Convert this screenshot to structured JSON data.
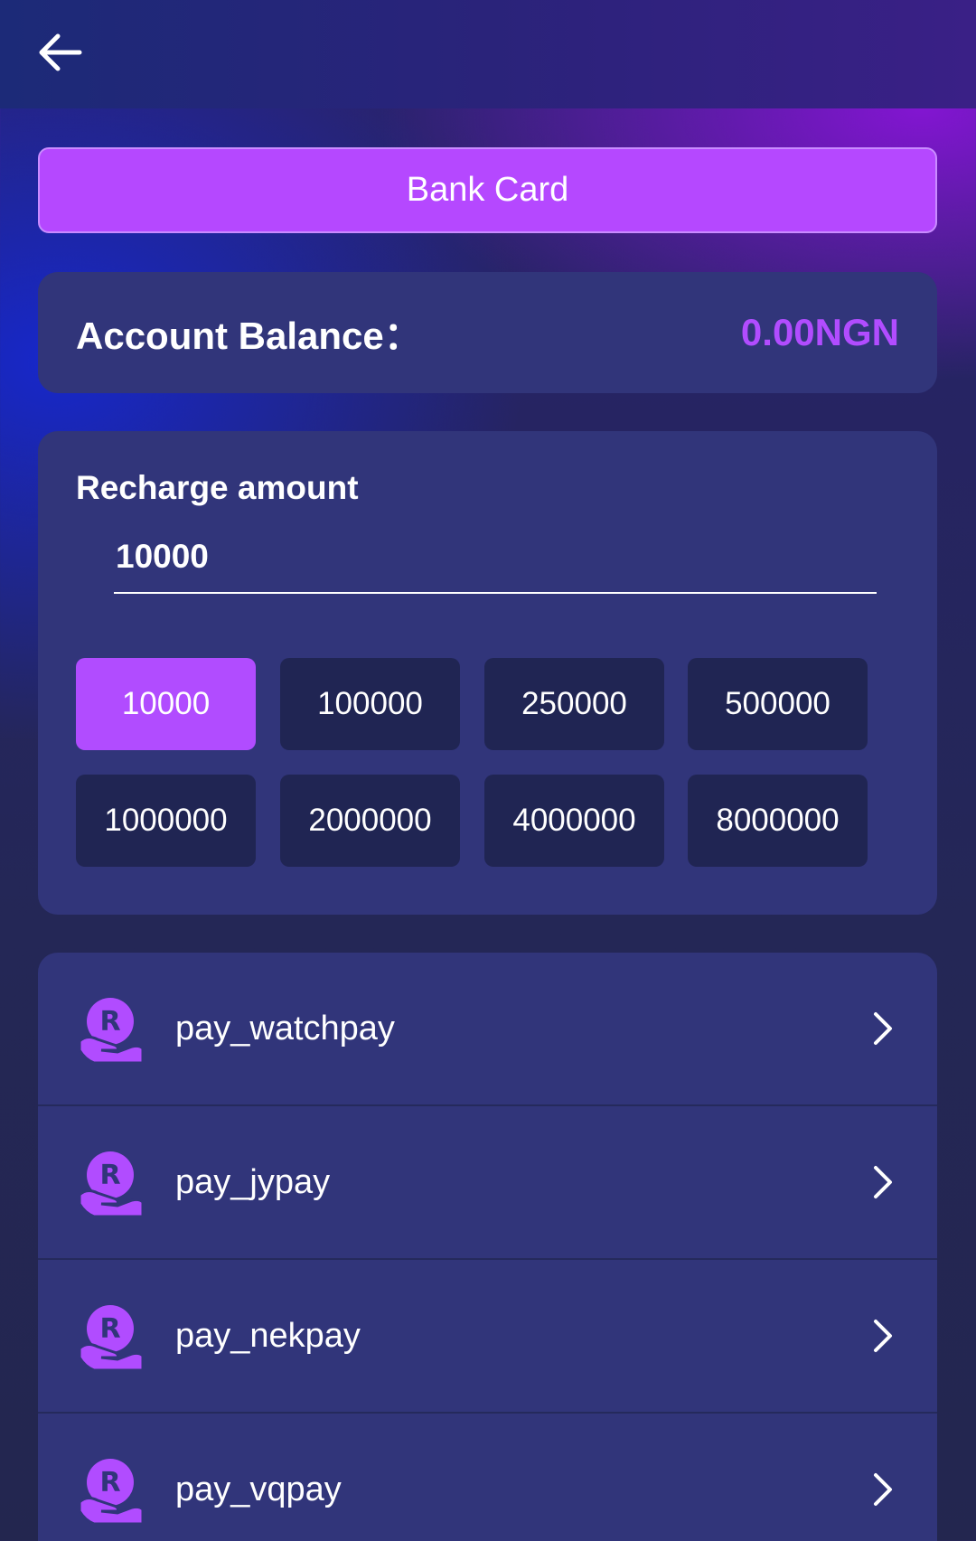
{
  "header": {
    "back_icon": "arrow-left-icon"
  },
  "tab": {
    "label": "Bank Card"
  },
  "balance": {
    "label": "Account Balance：",
    "value": "0.00NGN"
  },
  "recharge": {
    "title": "Recharge amount",
    "input_value": "10000",
    "options": [
      {
        "label": "10000",
        "selected": true
      },
      {
        "label": "100000",
        "selected": false
      },
      {
        "label": "250000",
        "selected": false
      },
      {
        "label": "500000",
        "selected": false
      },
      {
        "label": "1000000",
        "selected": false
      },
      {
        "label": "2000000",
        "selected": false
      },
      {
        "label": "4000000",
        "selected": false
      },
      {
        "label": "8000000",
        "selected": false
      }
    ]
  },
  "payment_channels": [
    {
      "label": "pay_watchpay",
      "icon": "hand-coin-icon"
    },
    {
      "label": "pay_jypay",
      "icon": "hand-coin-icon"
    },
    {
      "label": "pay_nekpay",
      "icon": "hand-coin-icon"
    },
    {
      "label": "pay_vqpay",
      "icon": "hand-coin-icon"
    }
  ],
  "colors": {
    "accent": "#b14cff",
    "card": "#31357a",
    "chip": "#202553"
  }
}
